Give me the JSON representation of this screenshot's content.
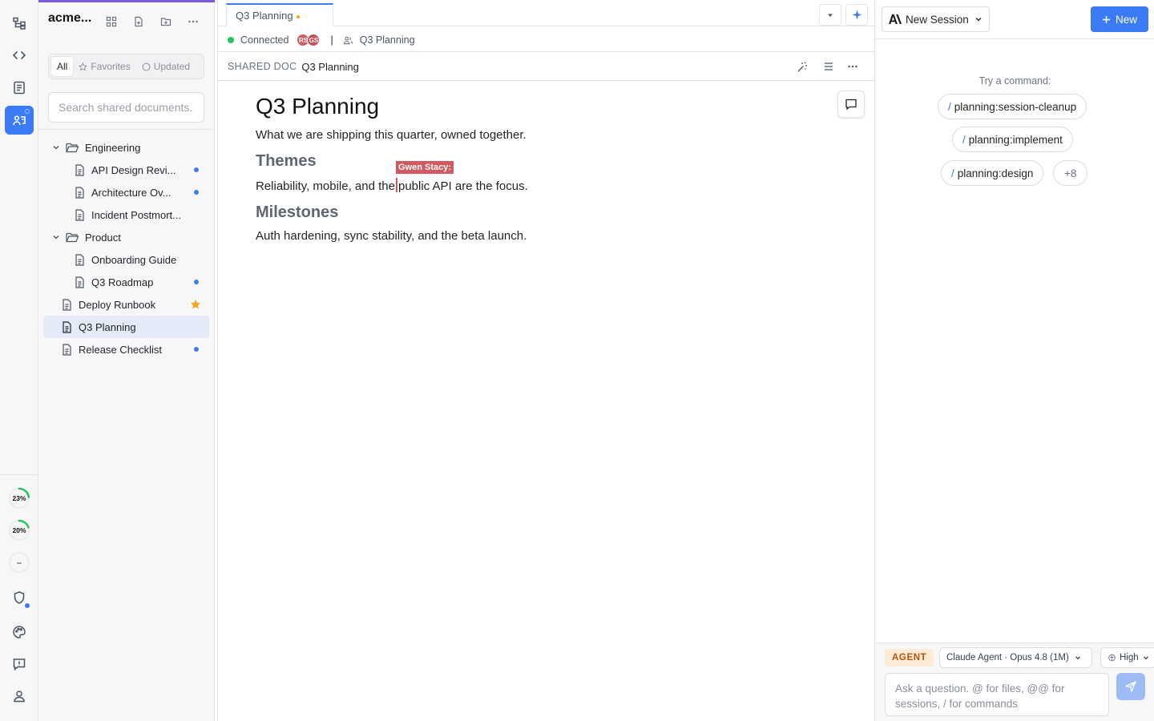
{
  "activity_bar": {
    "items": [
      {
        "icon": "hierarchy-icon",
        "active": false
      },
      {
        "icon": "code-icon",
        "active": false
      },
      {
        "icon": "clipboard-icon",
        "active": false
      },
      {
        "icon": "shared-docs-icon",
        "active": true
      }
    ],
    "usage": [
      {
        "label": "23%",
        "value": 0.23
      },
      {
        "label": "20%",
        "value": 0.2
      },
      {
        "label": "--",
        "value": 0
      }
    ],
    "bottom_items": [
      "shield-icon",
      "palette-icon",
      "feedback-icon",
      "user-icon"
    ]
  },
  "explorer": {
    "workspace_name": "acme...",
    "filters": [
      {
        "label": "All",
        "active": true
      },
      {
        "label": "Favorites",
        "active": false
      },
      {
        "label": "Updated",
        "active": false
      }
    ],
    "search_placeholder": "Search shared documents...",
    "tree": [
      {
        "type": "folder",
        "label": "Engineering",
        "depth": 0
      },
      {
        "type": "doc",
        "label": "API Design Revi...",
        "depth": 1,
        "badge": "dot"
      },
      {
        "type": "doc",
        "label": "Architecture Ov...",
        "depth": 1,
        "badge": "dot"
      },
      {
        "type": "doc",
        "label": "Incident Postmort...",
        "depth": 1,
        "badge": ""
      },
      {
        "type": "folder",
        "label": "Product",
        "depth": 0
      },
      {
        "type": "doc",
        "label": "Onboarding Guide",
        "depth": 1,
        "badge": ""
      },
      {
        "type": "doc",
        "label": "Q3 Roadmap",
        "depth": 1,
        "badge": "dot"
      },
      {
        "type": "doc",
        "label": "Deploy Runbook",
        "depth": 0,
        "badge": "star"
      },
      {
        "type": "doc",
        "label": "Q3 Planning",
        "depth": 0,
        "badge": "",
        "selected": true
      },
      {
        "type": "doc",
        "label": "Release Checklist",
        "depth": 0,
        "badge": "dot"
      }
    ]
  },
  "editor": {
    "tab": {
      "label": "Q3 Planning",
      "modified": true
    },
    "status": {
      "connection": "Connected",
      "collaborators": [
        {
          "initials": "RS",
          "color": "#d05a5f"
        },
        {
          "initials": "GS",
          "color": "#c75058"
        }
      ],
      "separator": "|",
      "room": "Q3 Planning"
    },
    "doc_header": {
      "kind": "SHARED DOC",
      "title": "Q3 Planning"
    },
    "document": {
      "title": "Q3 Planning",
      "intro": "What we are shipping this quarter, owned together.",
      "themes_heading": "Themes",
      "themes_text_before": "Reliability, mobile, and the",
      "themes_text_after": "public API are the focus.",
      "remote_cursor_label": "Gwen Stacy:",
      "milestones_heading": "Milestones",
      "milestones_text": "Auth hardening, sync stability, and the beta launch."
    }
  },
  "agent_panel": {
    "session_label": "New Session",
    "new_label": "New",
    "try_label": "Try a command:",
    "commands": [
      "planning:session-cleanup",
      "planning:implement",
      "planning:design"
    ],
    "slash": "/",
    "more_label": "+8",
    "mode_badge": "AGENT",
    "model_label": "Claude Agent · Opus 4.8 (1M)",
    "effort_label": "High",
    "input_placeholder": "Ask a question. @ for files, @@ for sessions, / for commands"
  },
  "colors": {
    "accent": "#3b7bf6",
    "connected": "#22c55e",
    "remote_cursor": "#d05a5f",
    "favorite": "#f4a325",
    "workspace_bar": "#7c5cdb"
  }
}
